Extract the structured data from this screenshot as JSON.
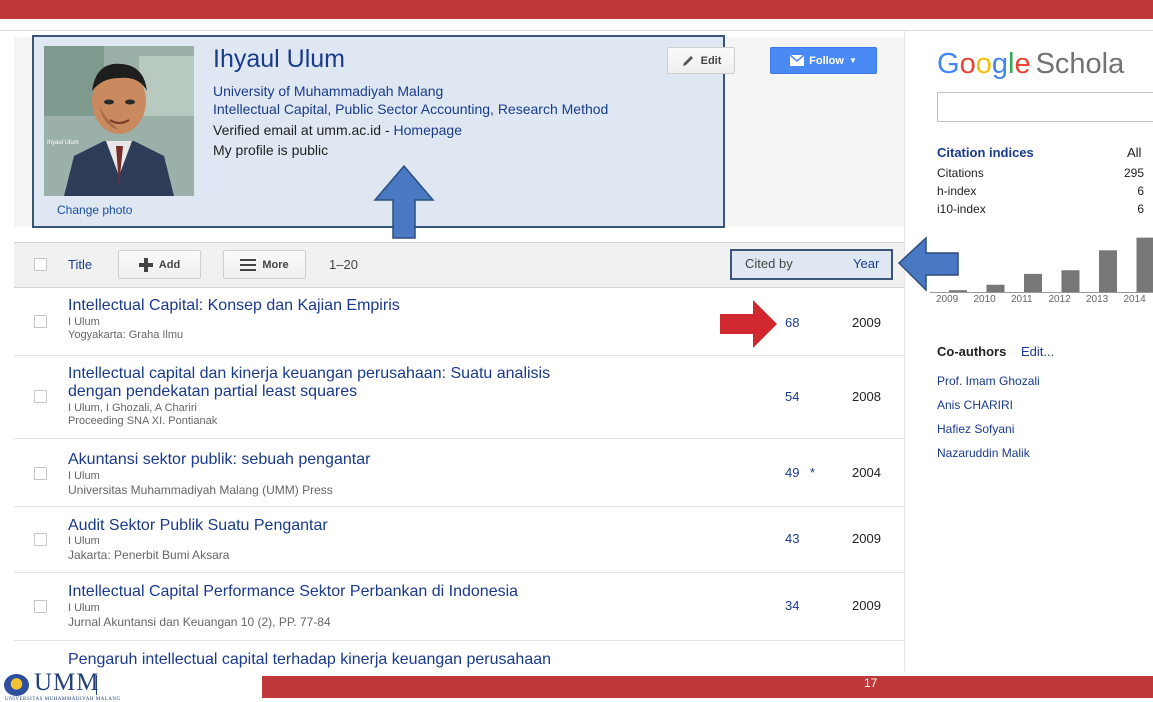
{
  "profile": {
    "name": "Ihyaul Ulum",
    "affiliation": "University of Muhammadiyah Malang",
    "interests": "Intellectual Capital, Public Sector Accounting, Research Method",
    "email_text": "Verified email at umm.ac.id - ",
    "homepage_link": "Homepage",
    "public_text": "My profile is public",
    "change_photo": "Change photo",
    "photo_caption": "Ihyaul Ulum",
    "edit_label": "Edit",
    "follow_label": "Follow"
  },
  "table": {
    "header": {
      "title": "Title",
      "add_label": "Add",
      "more_label": "More",
      "range": "1–20",
      "cited_by": "Cited by",
      "year": "Year"
    },
    "rows": [
      {
        "title_1": "Intellectual Capital: Konsep dan Kajian Empiris",
        "title_2": "",
        "authors": "I Ulum",
        "venue": "Yogyakarta: Graha Ilmu",
        "cited": "68",
        "star": "",
        "year": "2009"
      },
      {
        "title_1": "Intellectual capital dan kinerja keuangan perusahaan: Suatu analisis",
        "title_2": "dengan pendekatan partial least squares",
        "authors": "I Ulum, I Ghozali, A Chariri",
        "venue": "Proceeding SNA XI. Pontianak",
        "cited": "54",
        "star": "",
        "year": "2008"
      },
      {
        "title_1": "Akuntansi sektor publik: sebuah pengantar",
        "title_2": "",
        "authors": "I Ulum",
        "venue": "Universitas Muhammadiyah Malang (UMM) Press",
        "cited": "49",
        "star": "*",
        "year": "2004"
      },
      {
        "title_1": "Audit Sektor Publik Suatu Pengantar",
        "title_2": "",
        "authors": "I Ulum",
        "venue": "Jakarta: Penerbit Bumi Aksara",
        "cited": "43",
        "star": "",
        "year": "2009"
      },
      {
        "title_1": "Intellectual Capital Performance Sektor Perbankan di Indonesia",
        "title_2": "",
        "authors": "I Ulum",
        "venue": "Jurnal Akuntansi dan Keuangan 10 (2), PP. 77-84",
        "cited": "34",
        "star": "",
        "year": "2009"
      },
      {
        "title_1": "Pengaruh intellectual capital terhadap kinerja keuangan perusahaan",
        "title_2": "",
        "authors": "",
        "venue": "",
        "cited": "",
        "star": "",
        "year": ""
      }
    ]
  },
  "sidebar": {
    "logo": {
      "G": "G",
      "o1": "o",
      "o2": "o",
      "g": "g",
      "l": "l",
      "e": "e",
      "scholar": "Schola"
    },
    "citation_indices": {
      "title": "Citation indices",
      "all_label": "All",
      "rows": [
        {
          "label": "Citations",
          "value": "295"
        },
        {
          "label": "h-index",
          "value": "6"
        },
        {
          "label": "i10-index",
          "value": "6"
        }
      ]
    },
    "coauthors": {
      "title": "Co-authors",
      "edit": "Edit...",
      "names": [
        "Prof. Imam Ghozali",
        "Anis CHARIRI",
        "Hafiez Sofyani",
        "Nazaruddin Malik"
      ]
    }
  },
  "chart_data": {
    "type": "bar",
    "categories": [
      "2009",
      "2010",
      "2011",
      "2012",
      "2013",
      "2014"
    ],
    "values": [
      1,
      4,
      10,
      12,
      23,
      30
    ],
    "ylim": [
      0,
      32
    ],
    "bar_color": "#777777"
  },
  "footer": {
    "logo_text": "UMM",
    "logo_subtext": "UNIVERSITAS MUHAMMADIYAH MALANG",
    "page_number": "17",
    "band_color": "#c0393a"
  },
  "annotations": {
    "box_color": "#3a5577",
    "box_fill": "#dfe8f2",
    "arrow_blue": "#4a78c2",
    "arrow_red": "#d0282e"
  }
}
